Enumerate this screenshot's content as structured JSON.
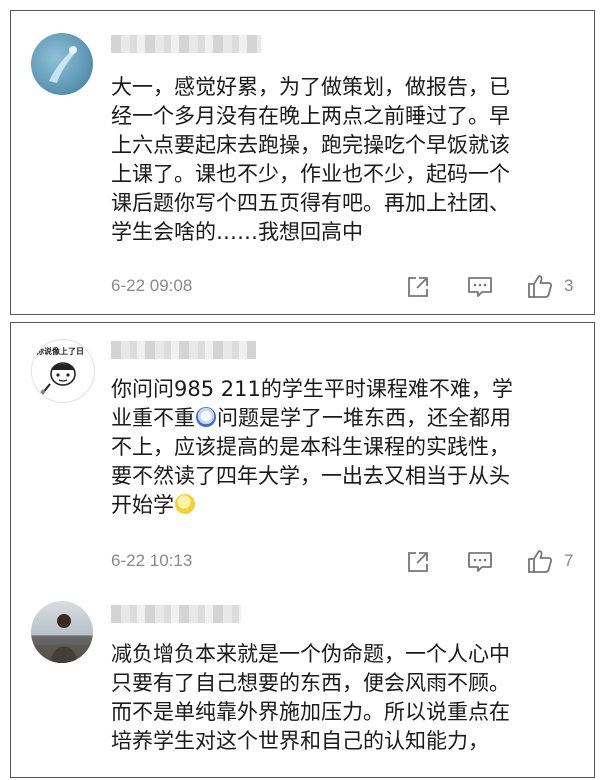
{
  "comments": [
    {
      "lines": [
        "大一，感觉好累，为了做策划，做报告，已",
        "经一个多月没有在晚上两点之前睡过了。早",
        "上六点要起床去跑操，跑完操吃个早饭就该",
        "上课了。课也不少，作业也不少，起码一个",
        "课后题你写个四五页得有吧。再加上社团、",
        "学生会啥的……我想回高中"
      ],
      "timestamp": "6-22 09:08",
      "likes": "3"
    },
    {
      "lines_a": [
        "你问问985 211的学生平时课程难不难，学",
        "业重不重"
      ],
      "line2_rest": "问题是学了一堆东西，还全都用",
      "lines_b": [
        "不上，应该提高的是本科生课程的实践性，",
        "要不然读了四年大学，一出去又相当于从头"
      ],
      "last_line": "开始学",
      "timestamp": "6-22 10:13",
      "likes": "7",
      "avatar_caption": "你说像上了日"
    },
    {
      "lines": [
        "减负增负本来就是一个伪命题，一个人心中",
        "只要有了自己想要的东西，便会风雨不顾。",
        "而不是单纯靠外界施加压力。所以说重点在",
        "培养学生对这个世界和自己的认知能力，"
      ]
    }
  ],
  "icons": {
    "share": "share-icon",
    "comment": "comment-icon",
    "like": "thumbs-up-icon"
  }
}
